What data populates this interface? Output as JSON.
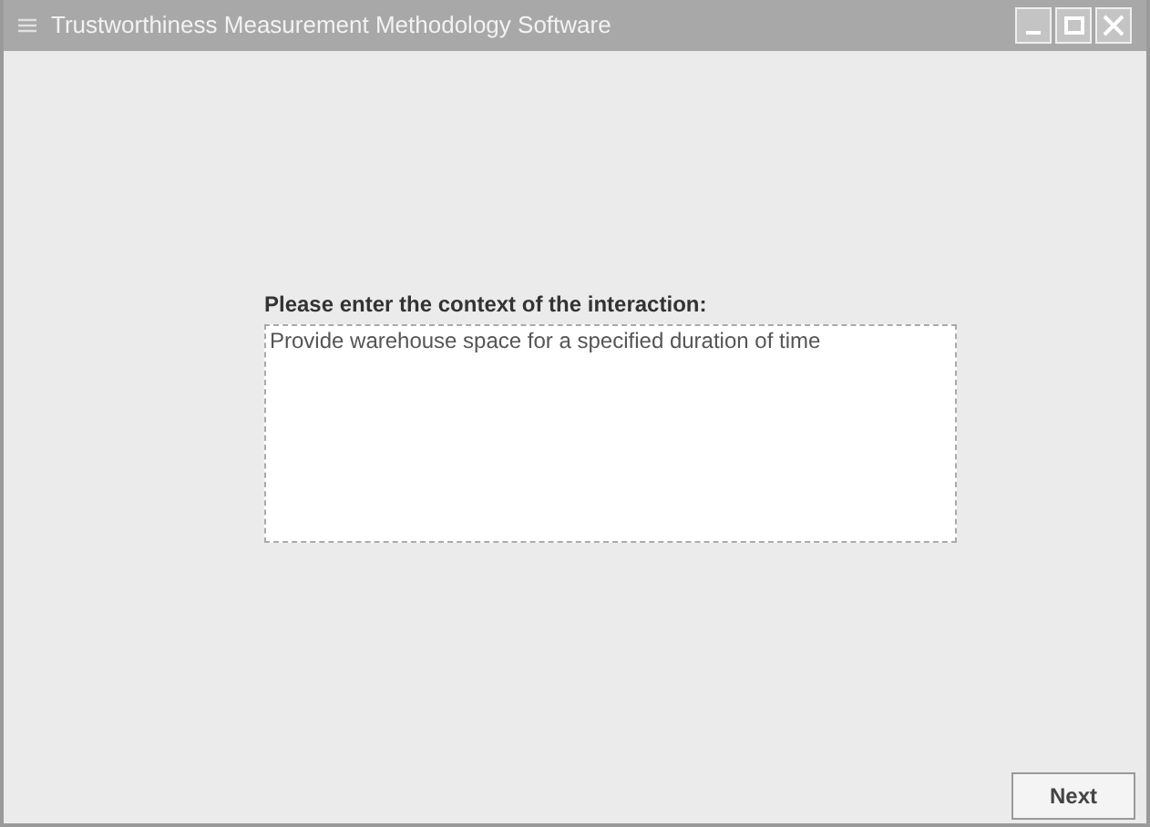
{
  "window": {
    "title": "Trustworthiness Measurement Methodology Software"
  },
  "prompt": "Please enter the context of the interaction:",
  "context_field": {
    "value": "Provide warehouse space for a specified duration of time"
  },
  "buttons": [
    {
      "label": "Next"
    }
  ]
}
